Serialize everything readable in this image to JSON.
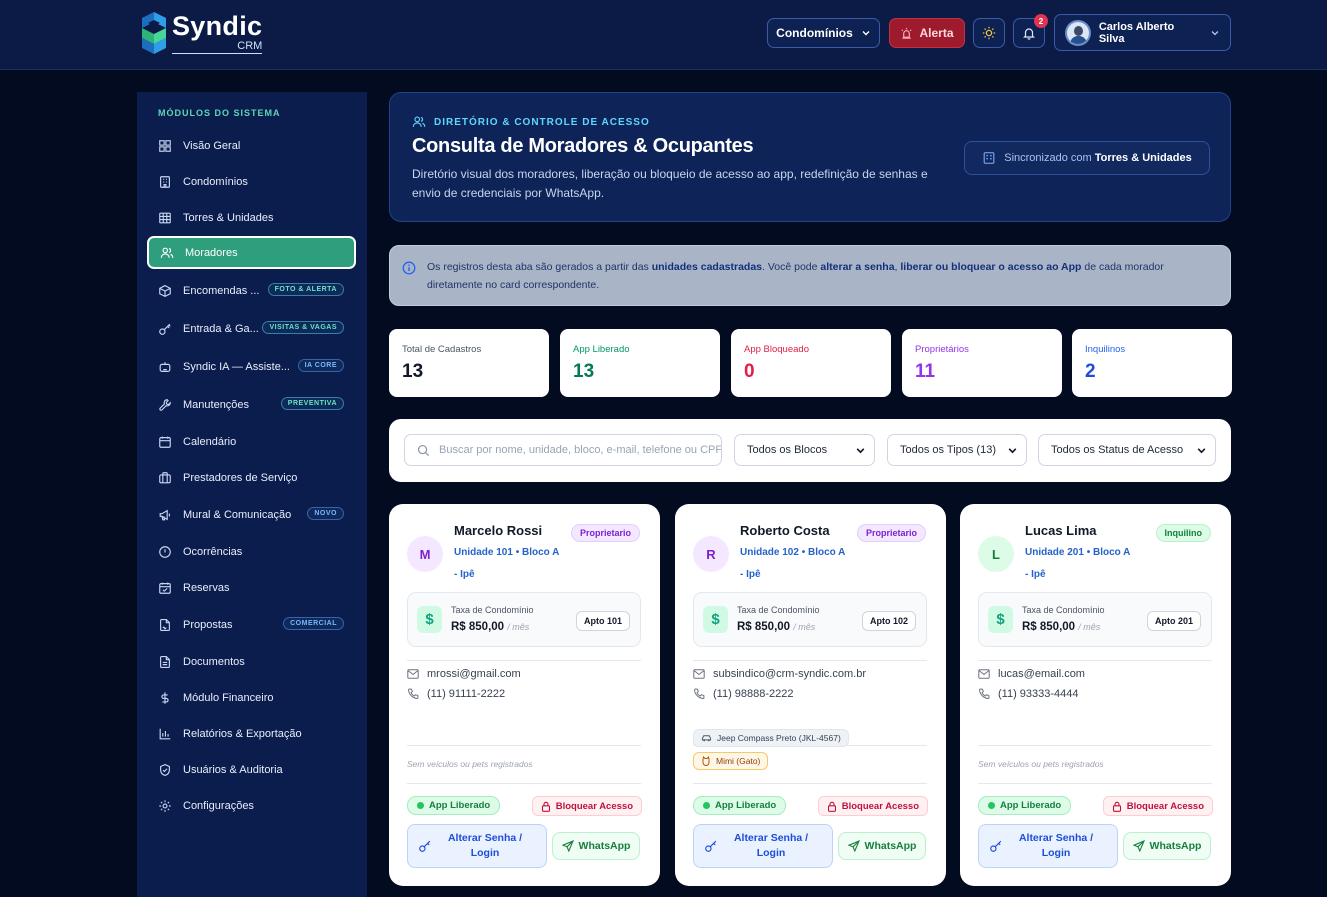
{
  "app": {
    "brand": "Syndic",
    "brand_sub": "CRM"
  },
  "header": {
    "condominios_label": "Condomínios",
    "alert_label": "Alerta",
    "notifications_count": "2",
    "user_name": "Carlos Alberto Silva"
  },
  "sidebar": {
    "title": "MÓDULOS DO SISTEMA",
    "items": [
      {
        "label": "Visão Geral",
        "icon": "grid-icon",
        "badge": ""
      },
      {
        "label": "Condomínios",
        "icon": "building-icon",
        "badge": ""
      },
      {
        "label": "Torres & Unidades",
        "icon": "table-icon",
        "badge": ""
      },
      {
        "label": "Moradores",
        "icon": "users-icon",
        "badge": "",
        "active": true
      },
      {
        "label": "Encomendas ...",
        "icon": "package-icon",
        "badge": "FOTO & ALERTA"
      },
      {
        "label": "Entrada & Ga...",
        "icon": "key-icon",
        "badge": "VISITAS & VAGAS"
      },
      {
        "label": "Syndic IA — Assiste...",
        "icon": "bot-icon",
        "badge": "IA CORE"
      },
      {
        "label": "Manutenções",
        "icon": "wrench-icon",
        "badge": "PREVENTIVA"
      },
      {
        "label": "Calendário",
        "icon": "calendar-icon",
        "badge": ""
      },
      {
        "label": "Prestadores de Serviço",
        "icon": "briefcase-icon",
        "badge": ""
      },
      {
        "label": "Mural & Comunicação",
        "icon": "megaphone-icon",
        "badge": "NOVO"
      },
      {
        "label": "Ocorrências",
        "icon": "alert-circle-icon",
        "badge": ""
      },
      {
        "label": "Reservas",
        "icon": "calendar-check-icon",
        "badge": ""
      },
      {
        "label": "Propostas",
        "icon": "file-signature-icon",
        "badge": "COMERCIAL"
      },
      {
        "label": "Documentos",
        "icon": "file-icon",
        "badge": ""
      },
      {
        "label": "Módulo Financeiro",
        "icon": "dollar-icon",
        "badge": ""
      },
      {
        "label": "Relatórios & Exportação",
        "icon": "bar-chart-icon",
        "badge": ""
      },
      {
        "label": "Usuários & Auditoria",
        "icon": "shield-icon",
        "badge": ""
      },
      {
        "label": "Configurações",
        "icon": "gear-icon",
        "badge": ""
      }
    ]
  },
  "hero": {
    "kicker": "DIRETÓRIO & CONTROLE DE ACESSO",
    "title": "Consulta de Moradores & Ocupantes",
    "description": "Diretório visual dos moradores, liberação ou bloqueio de acesso ao app, redefinição de senhas e envio de credenciais por WhatsApp.",
    "sync_prefix": "Sincronizado com",
    "sync_target": "Torres & Unidades"
  },
  "info": {
    "p1": "Os registros desta aba são gerados a partir das",
    "b1": "unidades cadastradas",
    "p2": ". Você pode",
    "b2": "alterar a senha",
    "p3": ",",
    "b3": "liberar ou bloquear o acesso ao App",
    "p4": "de cada morador diretamente no card correspondente."
  },
  "stats": [
    {
      "label": "Total de Cadastros",
      "value": "13",
      "color": "#111827",
      "label_color": "#4b5563"
    },
    {
      "label": "App Liberado",
      "value": "13",
      "color": "#047857",
      "label_color": "#059669"
    },
    {
      "label": "App Bloqueado",
      "value": "0",
      "color": "#e11d48",
      "label_color": "#e11d48"
    },
    {
      "label": "Proprietários",
      "value": "11",
      "color": "#9333ea",
      "label_color": "#9333ea"
    },
    {
      "label": "Inquilinos",
      "value": "2",
      "color": "#1d4ed8",
      "label_color": "#2563eb"
    }
  ],
  "filters": {
    "search_placeholder": "Buscar por nome, unidade, bloco, e-mail, telefone ou CPF...",
    "blocos": "Todos os Blocos",
    "tipos": "Todos os Tipos (13)",
    "status": "Todos os Status de Acesso"
  },
  "cards": [
    {
      "initial": "M",
      "name": "Marcelo Rossi",
      "unit": "Unidade 101 • Bloco A - Ipê",
      "role": "Proprietario",
      "role_type": "prop",
      "fee_label": "Taxa de Condomínio",
      "fee_value": "R$ 850,00",
      "fee_suffix": "/ mês",
      "apto": "Apto 101",
      "email": "mrossi@gmail.com",
      "phone": "(11) 91111-2222",
      "note": "Sem veículos ou pets registrados",
      "vehicle": "",
      "pet": "",
      "access": "App Liberado",
      "block_label": "Bloquear Acesso",
      "pass_label": "Alterar Senha / Login",
      "wa_label": "WhatsApp"
    },
    {
      "initial": "R",
      "name": "Roberto Costa",
      "unit": "Unidade 102 • Bloco A - Ipê",
      "role": "Proprietario",
      "role_type": "prop",
      "fee_label": "Taxa de Condomínio",
      "fee_value": "R$ 850,00",
      "fee_suffix": "/ mês",
      "apto": "Apto 102",
      "email": "subsindico@crm-syndic.com.br",
      "phone": "(11) 98888-2222",
      "note": "",
      "vehicle": "Jeep Compass Preto (JKL-4567)",
      "pet": "Mimi (Gato)",
      "access": "App Liberado",
      "block_label": "Bloquear Acesso",
      "pass_label": "Alterar Senha / Login",
      "wa_label": "WhatsApp"
    },
    {
      "initial": "L",
      "name": "Lucas Lima",
      "unit": "Unidade 201 • Bloco A - Ipê",
      "role": "Inquilino",
      "role_type": "inq",
      "fee_label": "Taxa de Condomínio",
      "fee_value": "R$ 850,00",
      "fee_suffix": "/ mês",
      "apto": "Apto 201",
      "email": "lucas@email.com",
      "phone": "(11) 93333-4444",
      "note": "Sem veículos ou pets registrados",
      "vehicle": "",
      "pet": "",
      "access": "App Liberado",
      "block_label": "Bloquear Acesso",
      "pass_label": "Alterar Senha / Login",
      "wa_label": "WhatsApp"
    }
  ]
}
